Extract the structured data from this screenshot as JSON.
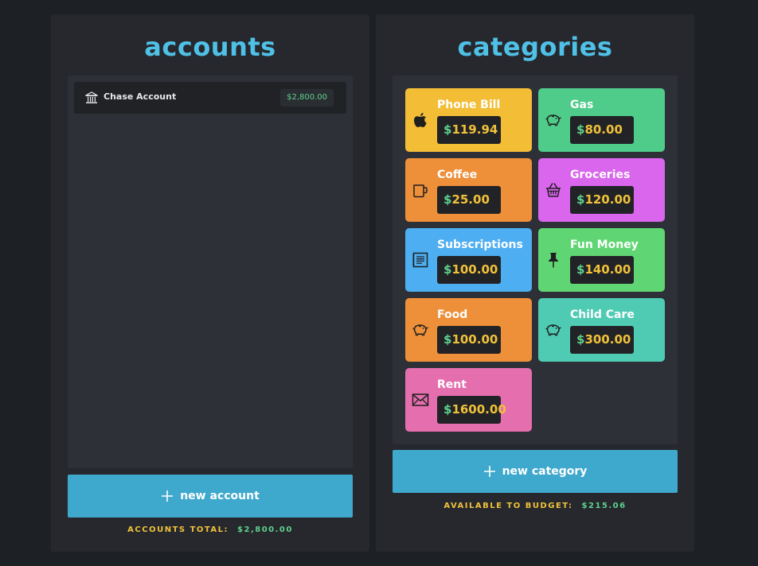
{
  "accounts": {
    "title": "accounts",
    "items": [
      {
        "name": "Chase Account",
        "balance": "$2,800.00",
        "icon": "bank-icon"
      }
    ],
    "new_button_label": "new account",
    "total_label": "ACCOUNTS TOTAL:",
    "total_value": "$2,800.00"
  },
  "categories": {
    "title": "categories",
    "items": [
      {
        "name": "Phone Bill",
        "amount": "119.94",
        "icon": "apple-icon",
        "color": "#f3bd35"
      },
      {
        "name": "Gas",
        "amount": "80.00",
        "icon": "piggy-bank-icon",
        "color": "#4fcb8a"
      },
      {
        "name": "Coffee",
        "amount": "25.00",
        "icon": "mug-icon",
        "color": "#ee8f3a"
      },
      {
        "name": "Groceries",
        "amount": "120.00",
        "icon": "basket-icon",
        "color": "#d966ed"
      },
      {
        "name": "Subscriptions",
        "amount": "100.00",
        "icon": "receipt-icon",
        "color": "#4daef1"
      },
      {
        "name": "Fun Money",
        "amount": "140.00",
        "icon": "pin-icon",
        "color": "#5fd673"
      },
      {
        "name": "Food",
        "amount": "100.00",
        "icon": "piggy-bank-icon",
        "color": "#ee8f3a"
      },
      {
        "name": "Child Care",
        "amount": "300.00",
        "icon": "piggy-bank-icon",
        "color": "#4fcbb4"
      },
      {
        "name": "Rent",
        "amount": "1600.00",
        "icon": "envelope-icon",
        "color": "#e56eae"
      }
    ],
    "currency_symbol": "$",
    "new_button_label": "new category",
    "budget_label": "AVAILABLE TO BUDGET:",
    "budget_value": "$215.06"
  },
  "colors": {
    "background": "#1d2024",
    "panel": "#26282d",
    "accent": "#4fc0e6",
    "button": "#3fa8cd",
    "money_green": "#5ed18e",
    "money_yellow": "#f0c23a"
  }
}
